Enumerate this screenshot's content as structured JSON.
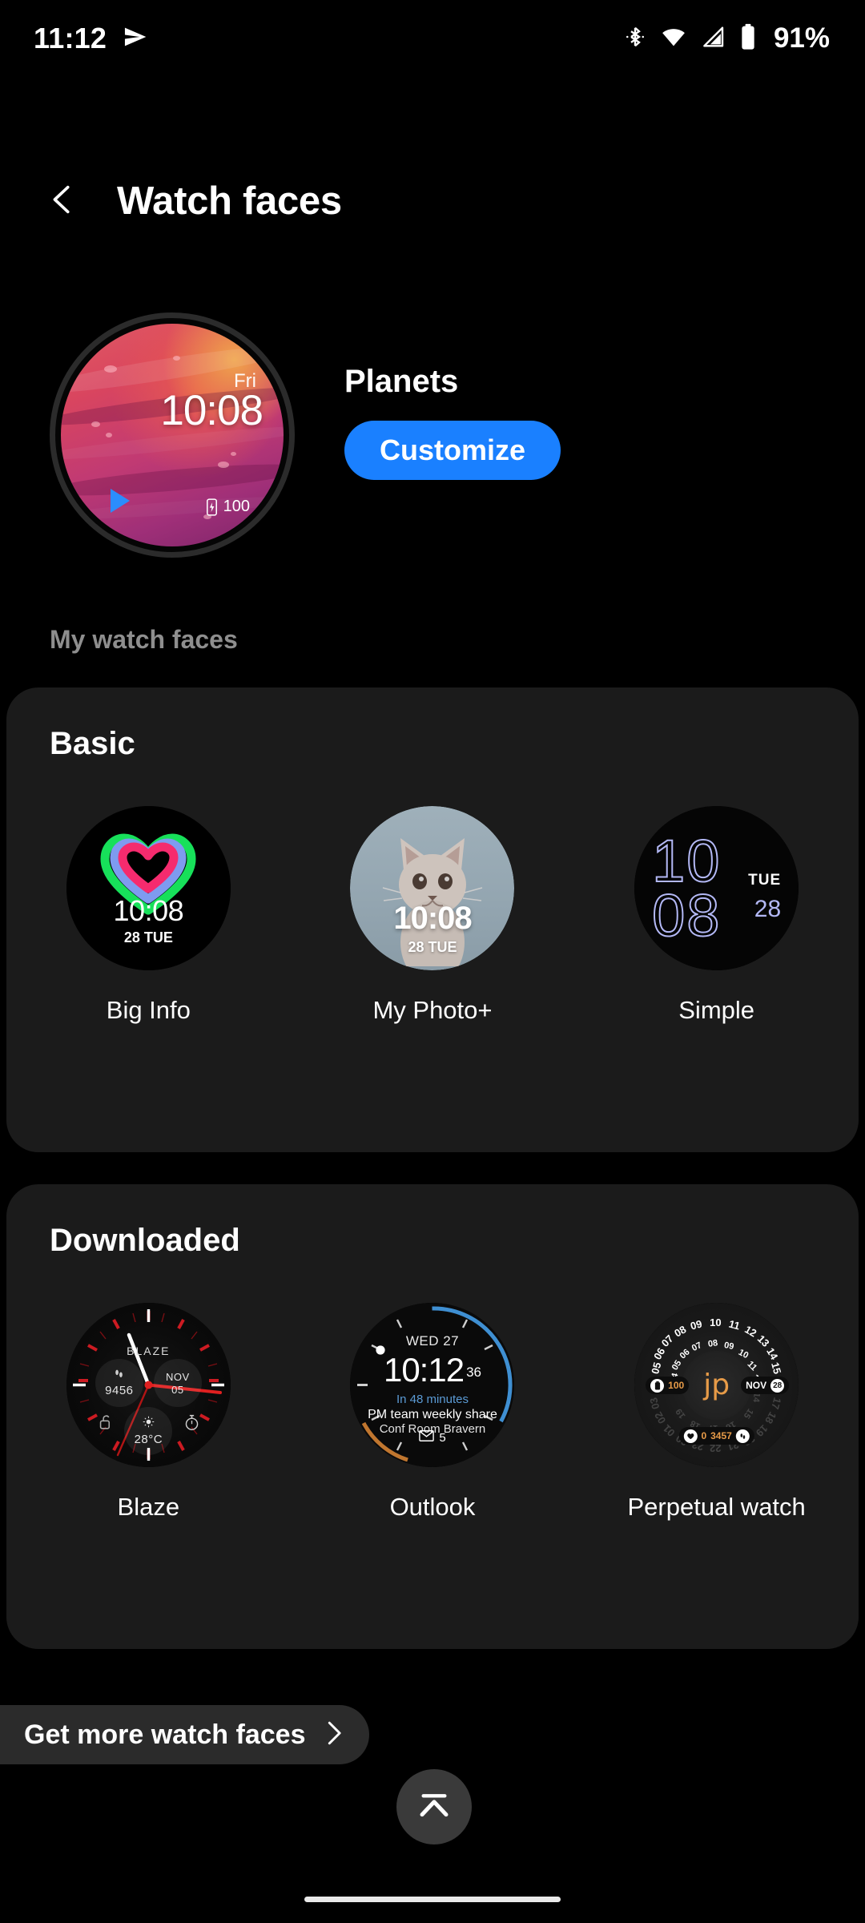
{
  "status_bar": {
    "time": "11:12",
    "battery_percent": "91%",
    "icons": [
      "send-icon",
      "bluetooth-icon",
      "wifi-icon",
      "signal-icon",
      "battery-icon"
    ]
  },
  "header": {
    "back_icon": "chevron-left-icon",
    "title": "Watch faces"
  },
  "current_face": {
    "name": "Planets",
    "customize_label": "Customize",
    "preview": {
      "day": "Fri",
      "time": "10:08",
      "battery": "100",
      "battery_icon": "battery-charging-icon",
      "play_icon": "play-icon"
    }
  },
  "my_watch_faces_label": "My watch faces",
  "sections": [
    {
      "title": "Basic",
      "faces": [
        {
          "label": "Big Info",
          "preview": {
            "time": "10:08",
            "date": "28 TUE",
            "graphic": "heart-rings"
          }
        },
        {
          "label": "My Photo+",
          "preview": {
            "time": "10:08",
            "date": "28 TUE",
            "graphic": "cat-photo"
          }
        },
        {
          "label": "Simple",
          "preview": {
            "hours": "10",
            "minutes": "08",
            "weekday": "TUE",
            "day": "28"
          }
        }
      ]
    },
    {
      "title": "Downloaded",
      "faces": [
        {
          "label": "Blaze",
          "preview": {
            "brand": "BLAZE",
            "steps": "9456",
            "steps_icon": "footsteps-icon",
            "month": "NOV",
            "day": "05",
            "temperature": "28°C",
            "weather_icon": "sun-icon",
            "lock_icon": "unlock-icon",
            "stopwatch_icon": "stopwatch-icon"
          }
        },
        {
          "label": "Outlook",
          "preview": {
            "date": "WED 27",
            "time": "10:12",
            "seconds": "36",
            "countdown": "In 48 minutes",
            "event_title": "PM team weekly share",
            "event_location": "Conf Room Bravern",
            "mail_count": "5",
            "mail_icon": "envelope-icon"
          }
        },
        {
          "label": "Perpetual watch",
          "preview": {
            "logo": "jp",
            "battery": "100",
            "battery_icon": "battery-icon",
            "month": "NOV",
            "day": "28",
            "heart_rate": "0",
            "heart_icon": "heart-icon",
            "steps": "3457",
            "steps_icon": "footsteps-icon",
            "outer_ring": [
              "05",
              "06",
              "07",
              "08",
              "09",
              "10",
              "11",
              "12",
              "13",
              "14",
              "15",
              "16",
              "17",
              "18",
              "19",
              "20",
              "21",
              "22",
              "23",
              "00",
              "01",
              "02",
              "03",
              "04"
            ],
            "inner_ring": [
              "05",
              "06",
              "07",
              "08",
              "09",
              "10",
              "11",
              "12",
              "13",
              "14",
              "15",
              "16",
              "17",
              "18",
              "19",
              "20",
              "21",
              "22",
              "23",
              "00",
              "01",
              "02",
              "03",
              "04"
            ]
          }
        }
      ]
    }
  ],
  "footer": {
    "get_more_label": "Get more watch faces",
    "get_more_icon": "chevron-right-icon",
    "scroll_top_icon": "chevron-up-icon"
  },
  "colors": {
    "accent_blue": "#1a80ff",
    "card_bg": "#1b1b1b",
    "page_bg": "#000000",
    "muted_text": "#8e8e8e",
    "outlook_blue": "#5b9bd5",
    "perpetual_orange": "#e79b48",
    "blaze_red": "#c1121f",
    "simple_periwinkle": "#b3b8f5"
  }
}
